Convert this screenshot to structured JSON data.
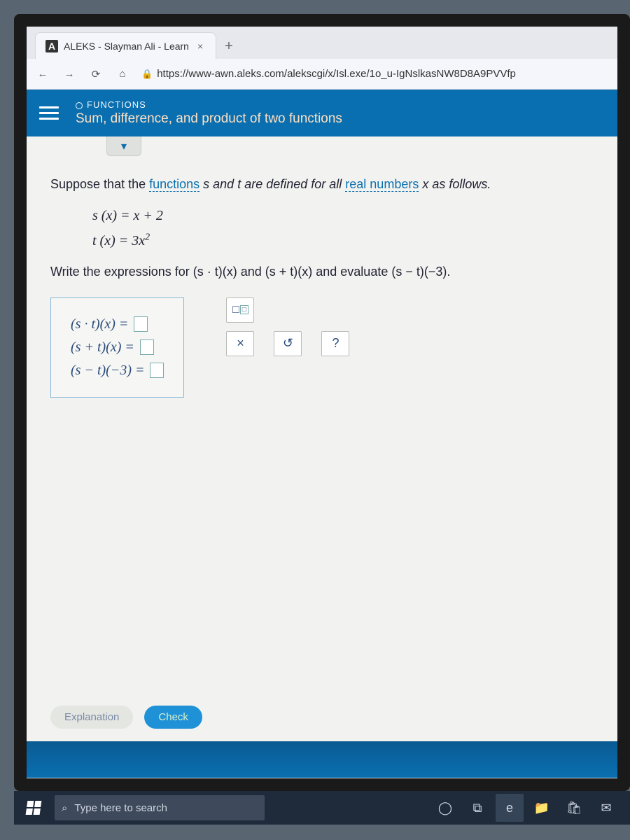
{
  "browser": {
    "tab_title": "ALEKS - Slayman Ali - Learn",
    "tab_favicon": "A",
    "url_display": "https://www-awn.aleks.com/alekscgi/x/Isl.exe/1o_u-IgNslkasNW8D8A9PVVfp"
  },
  "header": {
    "breadcrumb": "FUNCTIONS",
    "topic": "Sum, difference, and product of two functions"
  },
  "problem": {
    "intro_pre": "Suppose that the ",
    "intro_link1": "functions",
    "intro_mid": " s and t are defined for all ",
    "intro_link2": "real numbers",
    "intro_post": " x as follows.",
    "def_s": "s (x) = x + 2",
    "def_t": "t (x) = 3x",
    "def_t_exp": "2",
    "prompt": "Write the expressions for (s · t)(x) and (s + t)(x) and evaluate (s − t)(−3).",
    "ans1_label": "(s · t)(x) = ",
    "ans2_label": "(s + t)(x) = ",
    "ans3_label": "(s − t)(−3) = "
  },
  "tools": {
    "close": "×",
    "reset": "↺",
    "help": "?"
  },
  "actions": {
    "explanation": "Explanation",
    "check": "Check"
  },
  "taskbar": {
    "search_placeholder": "Type here to search"
  }
}
